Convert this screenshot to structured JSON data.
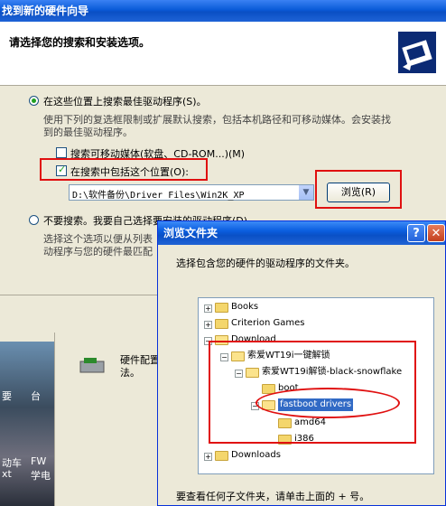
{
  "wizard": {
    "title": "找到新的硬件向导",
    "subtitle": "请选择您的搜索和安装选项。",
    "option_search_label": "在这些位置上搜索最佳驱动程序(S)。",
    "option_search_desc_1": "使用下列的复选框限制或扩展默认搜索，包括本机路径和可移动媒体。会安装找",
    "option_search_desc_2": "到的最佳驱动程序。",
    "check_removable_label": "搜索可移动媒体(软盘、CD-ROM...)(M)",
    "check_include_label": "在搜索中包括这个位置(O):",
    "path_value": "D:\\软件备份\\Driver Files\\Win2K_XP",
    "browse_button": "浏览(R)",
    "option_nosearch_label": "不要搜索。我要自己选择要安装的驱动程序(D)。",
    "option_nosearch_desc_1": "选择这个选项以便从列表",
    "option_nosearch_desc_2": "动程序与您的硬件最匹配"
  },
  "behind": {
    "label_1": "硬件配置",
    "label_2": "法。",
    "desk_labels": [
      "要",
      "台",
      "动车",
      "FW",
      "xt",
      "学电"
    ]
  },
  "browse": {
    "title": "浏览文件夹",
    "help_button": "?",
    "close_button": "✕",
    "instruction": "选择包含您的硬件的驱动程序的文件夹。",
    "footer": "要查看任何子文件夹，请单击上面的 + 号。",
    "tree": [
      {
        "label": "Books",
        "expander": "+"
      },
      {
        "label": "Criterion Games",
        "expander": "+"
      },
      {
        "label": "Download",
        "expander": "−"
      },
      {
        "label": "索爱WT19i一键解锁",
        "expander": "−"
      },
      {
        "label": "索爱WT19i解锁-black-snowflake",
        "expander": "−"
      },
      {
        "label": "boot",
        "expander": ""
      },
      {
        "label": "fastboot drivers",
        "expander": "−"
      },
      {
        "label": "amd64",
        "expander": ""
      },
      {
        "label": "i386",
        "expander": ""
      },
      {
        "label": "Downloads",
        "expander": "+"
      }
    ]
  },
  "colors": {
    "titlebar": "#0a5bd8",
    "annotation_red": "#e01010",
    "selection": "#316ac5"
  }
}
